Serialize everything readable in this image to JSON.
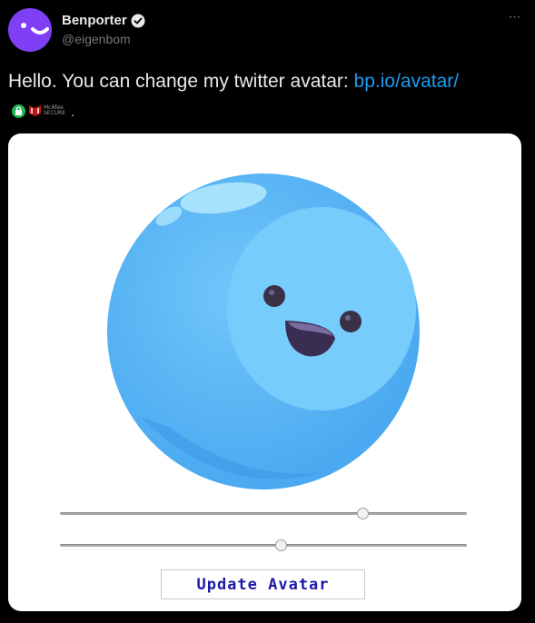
{
  "author": {
    "display_name": "Benporter",
    "handle": "@eigenbom",
    "verified_icon": "verified-badge-icon",
    "avatar_color": "#7f3ff5"
  },
  "more_menu": {
    "label": "···"
  },
  "tweet": {
    "text": "Hello. You can change my twitter avatar: ",
    "link_text": "bp.io/avatar/",
    "link_color": "#1d9bf0",
    "secure_badges": {
      "lock_icon": "lock-icon",
      "mcafee_line1": "McAfee",
      "mcafee_line2": "SECURE",
      "trailing": "."
    }
  },
  "card": {
    "blob_color": "#5ab7f5",
    "sliders": [
      {
        "name": "slider-1",
        "value": 0.745
      },
      {
        "name": "slider-2",
        "value": 0.545
      }
    ],
    "update_button_label": "Update Avatar"
  }
}
